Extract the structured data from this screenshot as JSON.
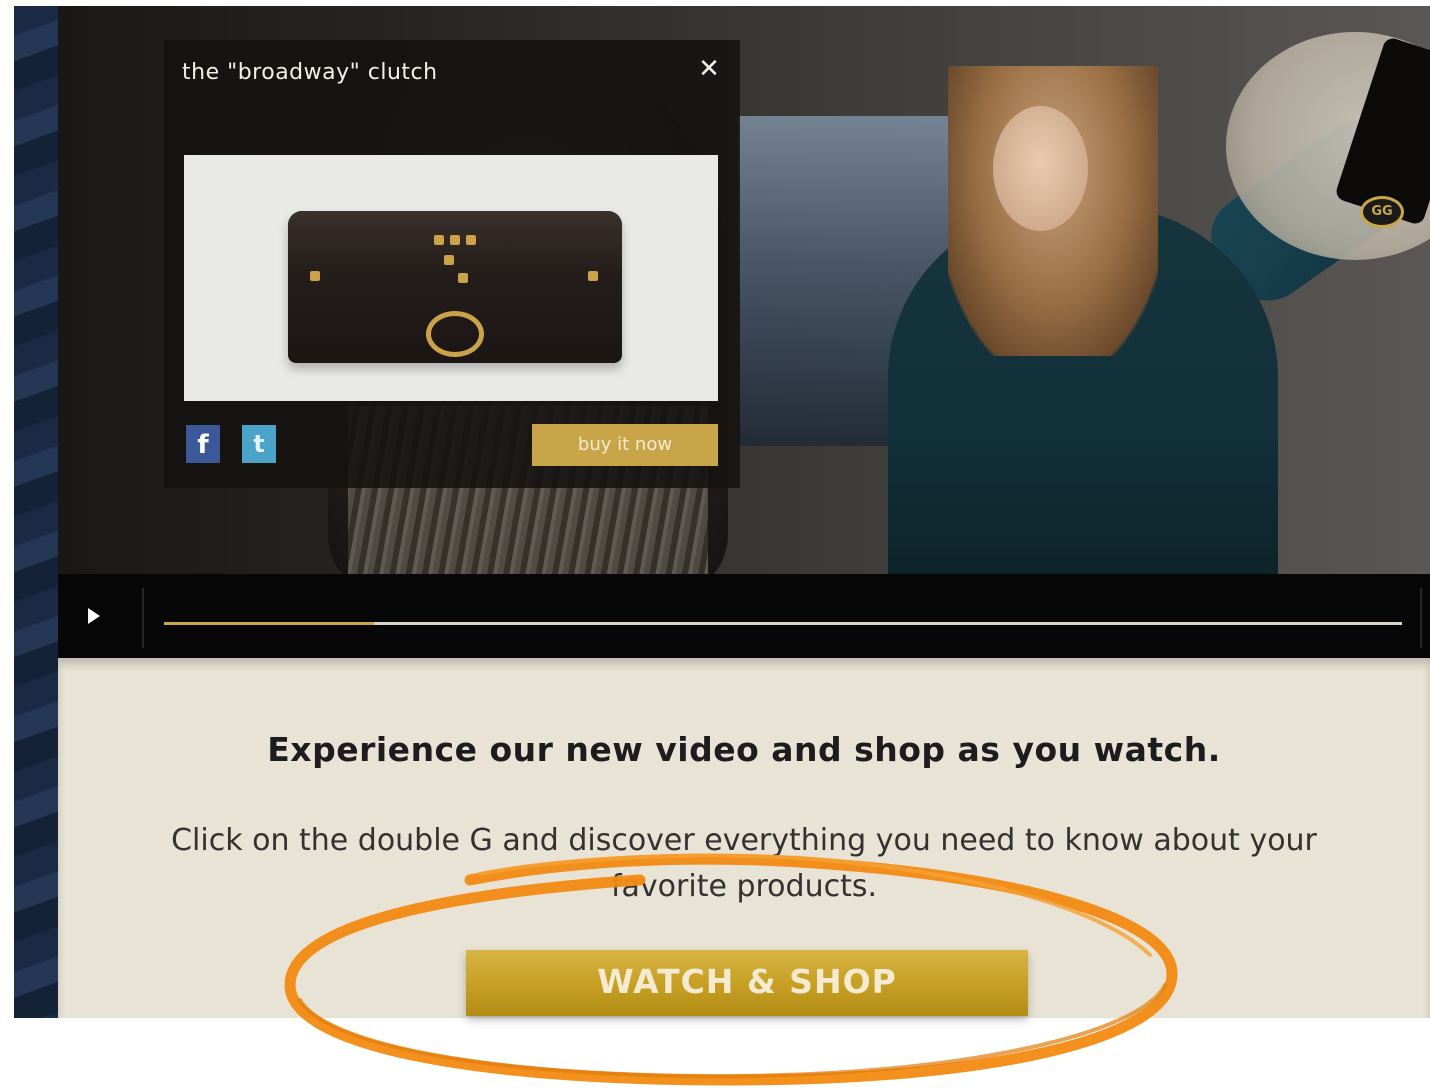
{
  "popup": {
    "title": "the \"broadway\" clutch",
    "close_icon": "close-icon",
    "facebook_icon": "f",
    "twitter_icon": "t",
    "buy_label": "buy it now"
  },
  "player": {
    "play_icon": "play-icon",
    "progress": 0.17
  },
  "hotspot": {
    "icon_label": "GG"
  },
  "info": {
    "headline": "Experience our new video and shop as you watch.",
    "description": "Click on the double G and discover everything you need to know about your favorite products.",
    "cta_label": "WATCH & SHOP"
  },
  "colors": {
    "gold": "#c9a54a",
    "panel_bg": "#e8e3d4",
    "annotation_orange": "#f28a12"
  }
}
